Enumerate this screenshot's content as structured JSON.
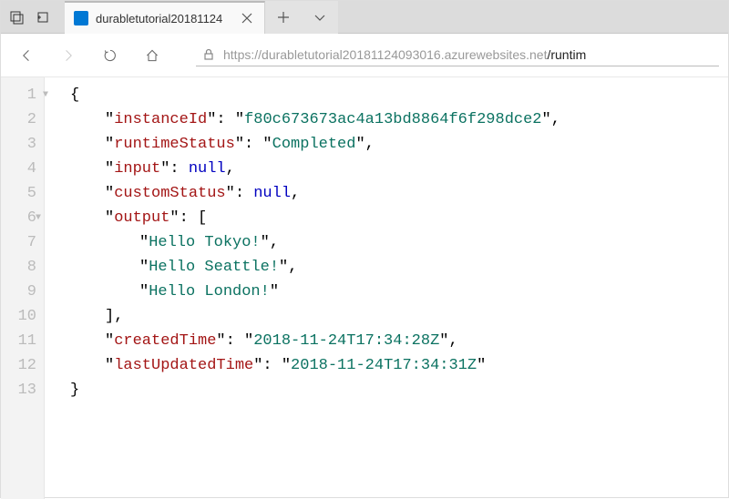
{
  "tab": {
    "title": "durabletutorial20181124"
  },
  "url": {
    "scheme": "https://",
    "host": "durabletutorial20181124093016.azurewebsites.net",
    "rest": "/runtim"
  },
  "json": {
    "keys": {
      "instanceId": "instanceId",
      "runtimeStatus": "runtimeStatus",
      "input": "input",
      "customStatus": "customStatus",
      "output": "output",
      "createdTime": "createdTime",
      "lastUpdatedTime": "lastUpdatedTime"
    },
    "values": {
      "instanceId": "f80c673673ac4a13bd8864f6f298dce2",
      "runtimeStatus": "Completed",
      "input": "null",
      "customStatus": "null",
      "output": [
        "Hello Tokyo!",
        "Hello Seattle!",
        "Hello London!"
      ],
      "createdTime": "2018-11-24T17:34:28Z",
      "lastUpdatedTime": "2018-11-24T17:34:31Z"
    }
  },
  "linecount": 13
}
